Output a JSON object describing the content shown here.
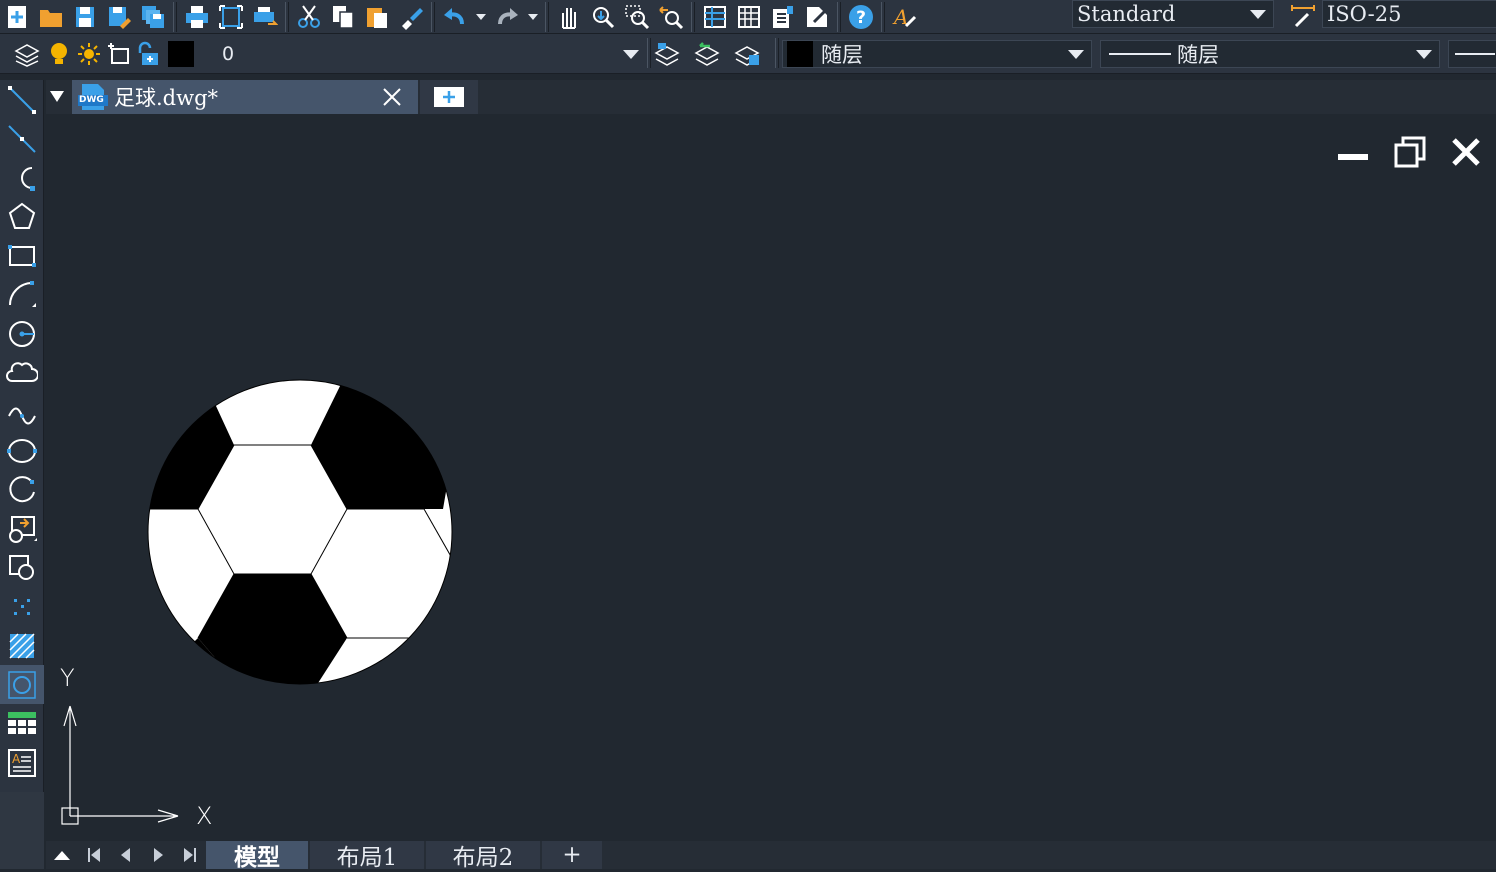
{
  "toolbar_standard": {
    "icons": [
      "new-file-icon",
      "open-folder-icon",
      "save-icon",
      "save-as-icon",
      "save-all-icon",
      "print-icon",
      "plot-preview-icon",
      "publish-icon",
      "cut-icon",
      "copy-icon",
      "paste-icon",
      "match-properties-icon",
      "undo-icon",
      "redo-icon",
      "pan-icon",
      "zoom-realtime-icon",
      "zoom-window-icon",
      "zoom-previous-icon",
      "properties-icon",
      "design-center-icon",
      "tool-palettes-icon",
      "markup-icon",
      "help-icon"
    ],
    "text_style": "Standard",
    "dim_style": "ISO-25"
  },
  "toolbar_layers": {
    "layer_name": "0",
    "color_value": "随层",
    "linetype_value": "随层",
    "layer_color": "#000000"
  },
  "document_tab": {
    "title": "足球.dwg*",
    "file_badge": "DWG"
  },
  "left_toolbar": {
    "tools": [
      "line-tool-icon",
      "construction-line-tool-icon",
      "polyline-tool-icon",
      "polygon-tool-icon",
      "rectangle-tool-icon",
      "arc-tool-icon",
      "circle-tool-icon",
      "revision-cloud-tool-icon",
      "spline-tool-icon",
      "ellipse-tool-icon",
      "ellipse-arc-tool-icon",
      "insert-block-tool-icon",
      "make-block-tool-icon",
      "point-tool-icon",
      "hatch-tool-icon",
      "region-tool-icon",
      "table-tool-icon",
      "multiline-text-tool-icon"
    ]
  },
  "ucs": {
    "x_label": "X",
    "y_label": "Y"
  },
  "layout_tabs": {
    "tabs": [
      "模型",
      "布局1",
      "布局2"
    ],
    "active": "模型",
    "add_label": "+"
  },
  "colors": {
    "accent": "#45556b",
    "canvas": "#212830",
    "toolbar": "#2c3440",
    "icon_blue": "#3aa0e8"
  }
}
